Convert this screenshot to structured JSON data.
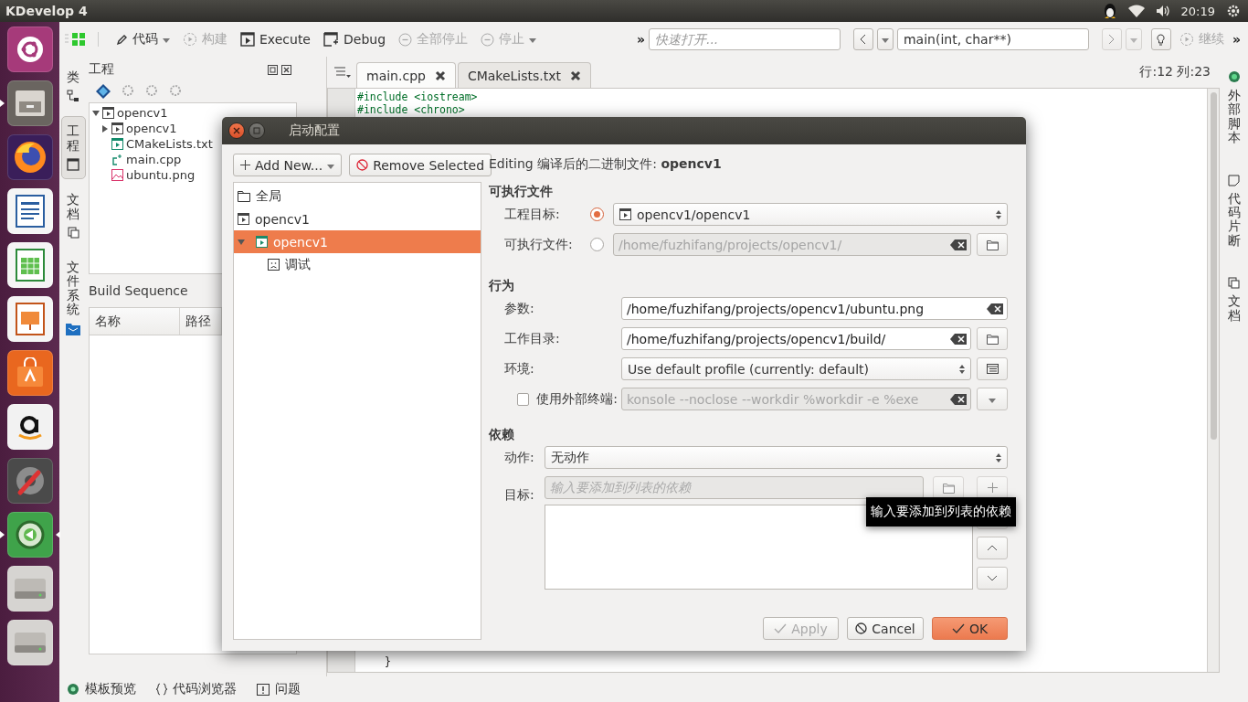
{
  "top_bar": {
    "title": "KDevelop 4",
    "time": "20:19"
  },
  "launcher": [
    {
      "kind": "ubuntu",
      "running": false
    },
    {
      "kind": "files",
      "running": true
    },
    {
      "kind": "browser",
      "running": false
    },
    {
      "kind": "writer",
      "running": false
    },
    {
      "kind": "calc",
      "running": false
    },
    {
      "kind": "impress",
      "running": false
    },
    {
      "kind": "store",
      "running": false
    },
    {
      "kind": "shop",
      "running": false
    },
    {
      "kind": "settings",
      "running": false
    },
    {
      "kind": "ide",
      "running": true
    },
    {
      "kind": "drive",
      "running": false
    },
    {
      "kind": "drive",
      "running": false
    }
  ],
  "toolbar": {
    "items": [
      {
        "kind": "grid"
      },
      {
        "kind": "code",
        "label": "代码",
        "dropdown": true,
        "disabled": false
      },
      {
        "kind": "build",
        "label": "构建",
        "dropdown": false,
        "disabled": true
      },
      {
        "kind": "execute",
        "label": "Execute",
        "dropdown": false,
        "disabled": false
      },
      {
        "kind": "debug",
        "label": "Debug",
        "dropdown": false,
        "disabled": false
      },
      {
        "kind": "stop",
        "label": "全部停止",
        "dropdown": false,
        "disabled": true
      },
      {
        "kind": "stop",
        "label": "停止",
        "dropdown": true,
        "disabled": true
      }
    ],
    "quick_open": {
      "placeholder": "快速打开..."
    },
    "context": {
      "value": "main(int, char**)"
    },
    "continue": {
      "label": "继续",
      "disabled": true
    },
    "overflow": [
      "»",
      "»"
    ]
  },
  "left_tabs": [
    {
      "label": "类",
      "kind": "classes",
      "selected": false
    },
    {
      "label": "工程",
      "kind": "project",
      "selected": true
    },
    {
      "label": "文档",
      "kind": "documents",
      "selected": false
    },
    {
      "label": "文件系统",
      "kind": "filesystem",
      "selected": false
    }
  ],
  "project_panel": {
    "title": "工程",
    "tree": [
      {
        "label": "opencv1",
        "kind": "project",
        "expanded": true,
        "children": [
          {
            "label": "opencv1",
            "kind": "project",
            "expanded": false,
            "has_children": true
          },
          {
            "label": "CMakeLists.txt",
            "kind": "cmake"
          },
          {
            "label": "main.cpp",
            "kind": "cpp"
          },
          {
            "label": "ubuntu.png",
            "kind": "image"
          }
        ]
      }
    ]
  },
  "build_sequence": {
    "title": "Build Sequence",
    "columns": [
      "名称",
      "路径"
    ]
  },
  "editor": {
    "tabs": [
      {
        "label": "main.cpp",
        "selected": true
      },
      {
        "label": "CMakeLists.txt",
        "selected": false
      }
    ],
    "cursor": "行:12 列:23",
    "code_top": [
      "#include <iostream>",
      "#include <chrono>"
    ],
    "code_bottom": [
      "}"
    ]
  },
  "right_tabs": [
    {
      "label": "外部脚本",
      "kind": "scripts"
    },
    {
      "label": "代码片断",
      "kind": "snippets"
    },
    {
      "label": "文档",
      "kind": "documents"
    }
  ],
  "status_bar": [
    {
      "label": "模板预览",
      "kind": "template"
    },
    {
      "label": "代码浏览器",
      "kind": "browser"
    },
    {
      "label": "问题",
      "kind": "problems"
    }
  ],
  "dialog": {
    "title": "启动配置",
    "add_button": "Add New...",
    "remove_button": "Remove Selected",
    "configs": [
      {
        "label": "全局",
        "kind": "global",
        "selected": false
      },
      {
        "label": "opencv1",
        "kind": "project",
        "selected": false
      },
      {
        "label": "opencv1",
        "kind": "launch",
        "selected": true,
        "expanded": true,
        "children": [
          {
            "label": "调试",
            "kind": "mode",
            "selected": false
          }
        ]
      }
    ],
    "editing": "Editing 编译后的二进制文件: **opencv1**",
    "executable": {
      "title": "可执行文件",
      "rows": [
        {
          "label": "工程目标:",
          "selected": true,
          "kind": "combo",
          "value": "opencv1/opencv1",
          "disabled": false
        },
        {
          "label": "可执行文件:",
          "selected": false,
          "kind": "path",
          "value": "/home/fuzhifang/projects/opencv1/",
          "disabled": true
        }
      ]
    },
    "behavior": {
      "title": "行为",
      "rows": [
        {
          "label": "参数:",
          "kind": "text",
          "value": "/home/fuzhifang/projects/opencv1/ubuntu.png",
          "disabled": false
        },
        {
          "label": "工作目录:",
          "kind": "path",
          "value": "/home/fuzhifang/projects/opencv1/build/",
          "disabled": false
        },
        {
          "label": "环境:",
          "kind": "profile",
          "value": "Use default profile (currently: default)",
          "disabled": false
        },
        {
          "label": "使用外部终端:",
          "kind": "terminal",
          "checked": false,
          "value": "konsole --noclose --workdir %workdir -e %exe",
          "disabled": true
        }
      ]
    },
    "dependencies": {
      "title": "依赖",
      "action_label": "动作:",
      "action_value": "无动作",
      "target_label": "目标:",
      "target_placeholder": "输入要添加到列表的依赖"
    },
    "tooltip": "输入要添加到列表的依赖",
    "buttons": [
      {
        "kind": "apply",
        "label": "Apply",
        "disabled": true
      },
      {
        "kind": "cancel",
        "label": "Cancel",
        "disabled": false
      },
      {
        "kind": "ok",
        "label": "OK",
        "disabled": false
      }
    ]
  }
}
